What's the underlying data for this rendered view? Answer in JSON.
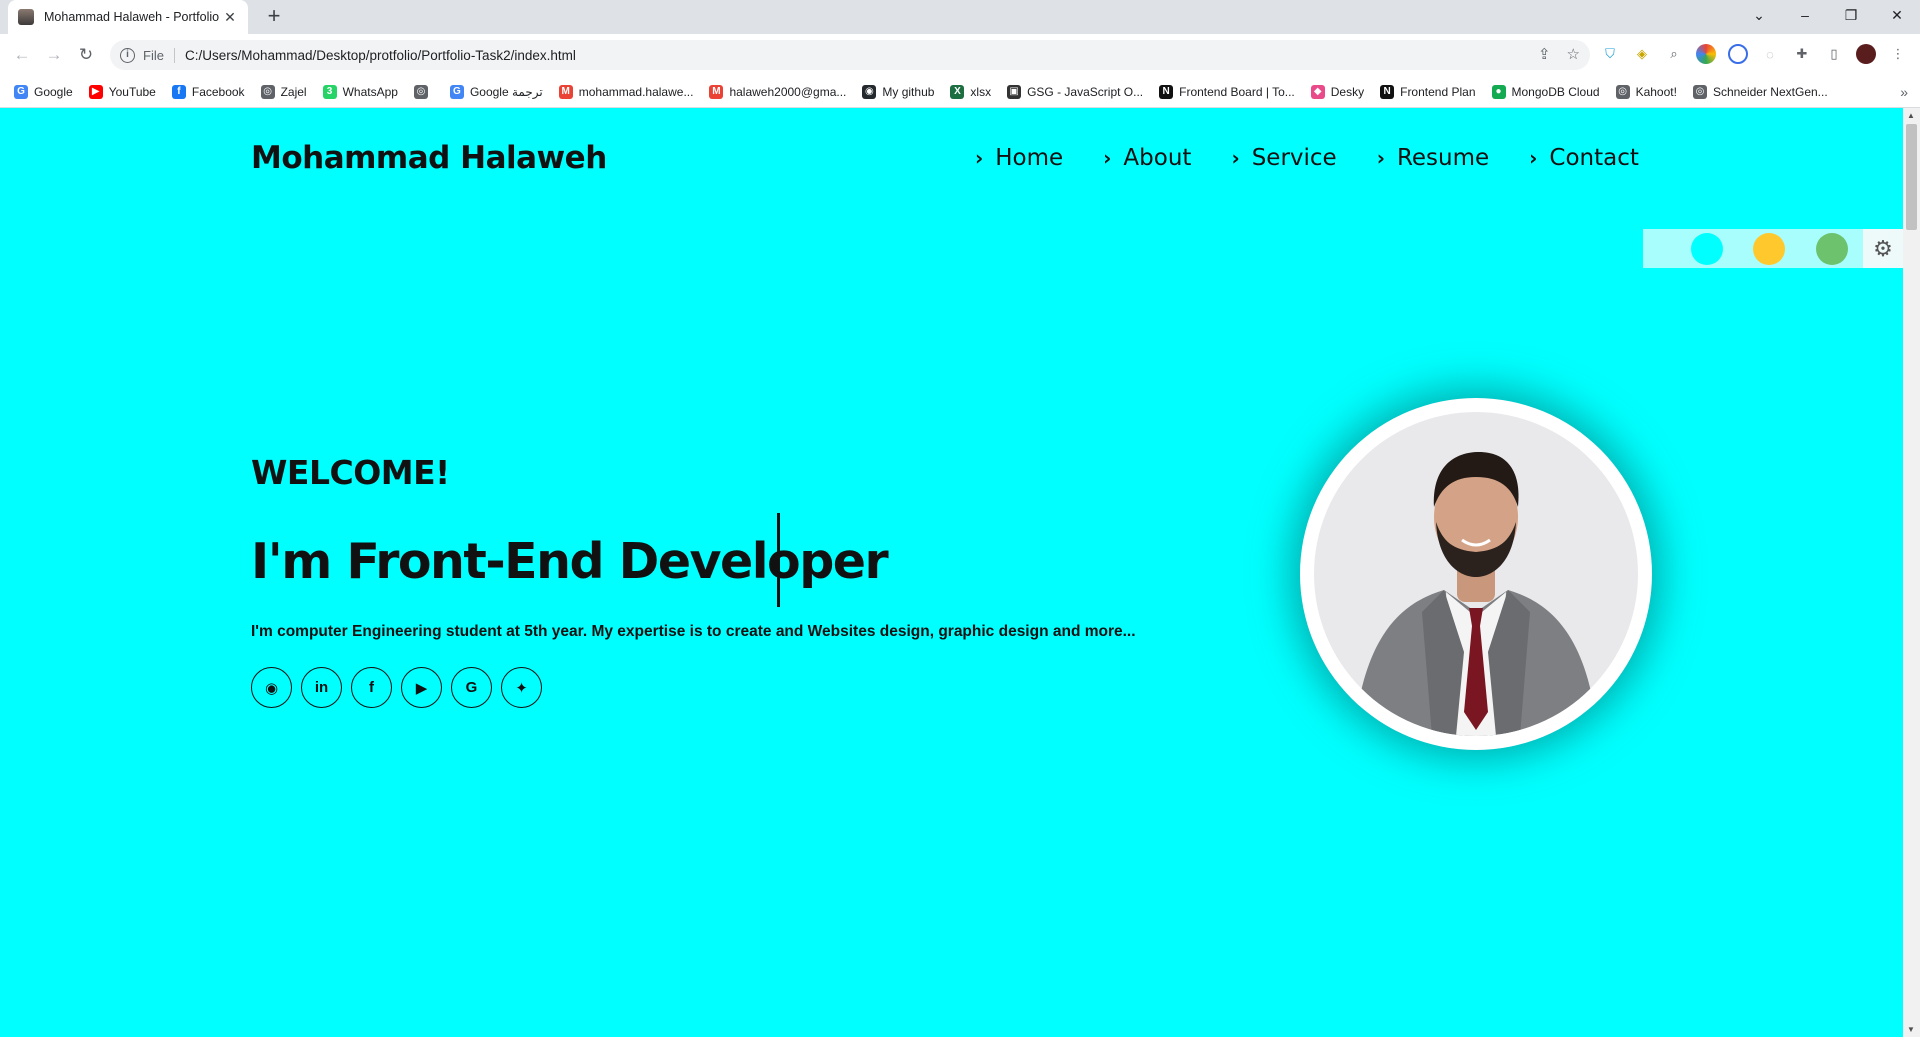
{
  "browser": {
    "tab_title": "Mohammad Halaweh - Portfolio",
    "tab_close": "✕",
    "new_tab": "+",
    "window_controls": [
      "⌄",
      "–",
      "❐",
      "✕"
    ],
    "omnibox_scheme_label": "File",
    "url": "C:/Users/Mohammad/Desktop/protfolio/Portfolio-Task2/index.html"
  },
  "bookmarks": [
    {
      "label": "Google",
      "icon": "google-icon",
      "color": "#4285f4",
      "glyph": "G"
    },
    {
      "label": "YouTube",
      "icon": "youtube-icon",
      "color": "#ff0000",
      "glyph": "▶"
    },
    {
      "label": "Facebook",
      "icon": "facebook-icon",
      "color": "#1877f2",
      "glyph": "f"
    },
    {
      "label": "Zajel",
      "icon": "globe-icon",
      "color": "#5f6368",
      "glyph": "◎"
    },
    {
      "label": "WhatsApp",
      "icon": "whatsapp-icon",
      "color": "#25d366",
      "glyph": "3"
    },
    {
      "label": "",
      "icon": "globe-icon",
      "color": "#5f6368",
      "glyph": "◎"
    },
    {
      "label": "Google ترجمة",
      "icon": "translate-icon",
      "color": "#4285f4",
      "glyph": "G"
    },
    {
      "label": "mohammad.halawe...",
      "icon": "gmail-icon",
      "color": "#ea4335",
      "glyph": "M"
    },
    {
      "label": "halaweh2000@gma...",
      "icon": "gmail-icon",
      "color": "#ea4335",
      "glyph": "M"
    },
    {
      "label": "My github",
      "icon": "github-icon",
      "color": "#24292e",
      "glyph": "◉"
    },
    {
      "label": "xlsx",
      "icon": "excel-icon",
      "color": "#1d6f42",
      "glyph": "X"
    },
    {
      "label": "GSG - JavaScript O...",
      "icon": "contact-card-icon",
      "color": "#333333",
      "glyph": "▣"
    },
    {
      "label": "Frontend Board | To...",
      "icon": "notion-icon",
      "color": "#111111",
      "glyph": "N"
    },
    {
      "label": "Desky",
      "icon": "desky-icon",
      "color": "#e84a8a",
      "glyph": "◆"
    },
    {
      "label": "Frontend Plan",
      "icon": "notion-icon",
      "color": "#111111",
      "glyph": "N"
    },
    {
      "label": "MongoDB Cloud",
      "icon": "mongodb-icon",
      "color": "#13aa52",
      "glyph": "●"
    },
    {
      "label": "Kahoot!",
      "icon": "globe-icon",
      "color": "#5f6368",
      "glyph": "◎"
    },
    {
      "label": "Schneider NextGen...",
      "icon": "globe-icon",
      "color": "#5f6368",
      "glyph": "◎"
    }
  ],
  "site": {
    "brand": "Mohammad Halaweh",
    "nav": [
      "Home",
      "About",
      "Service",
      "Resume",
      "Contact"
    ],
    "nav_chevron": "›",
    "theme_swatches": [
      "#00ffff",
      "#ffc82c",
      "#6dc36d"
    ],
    "gear_glyph": "⚙",
    "welcome": "WELCOME!",
    "headline": "I'm Front-End Developer",
    "bio": "I'm computer Engineering student at 5th year. My expertise is to create and Websites design, graphic design and more...",
    "socials": [
      {
        "name": "github-icon",
        "glyph": "◉"
      },
      {
        "name": "linkedin-icon",
        "glyph": "in"
      },
      {
        "name": "facebook-icon",
        "glyph": "f"
      },
      {
        "name": "youtube-icon",
        "glyph": "▶"
      },
      {
        "name": "google-icon",
        "glyph": "G"
      },
      {
        "name": "twitter-icon",
        "glyph": "✦"
      }
    ],
    "accent_color": "#00ffff"
  }
}
